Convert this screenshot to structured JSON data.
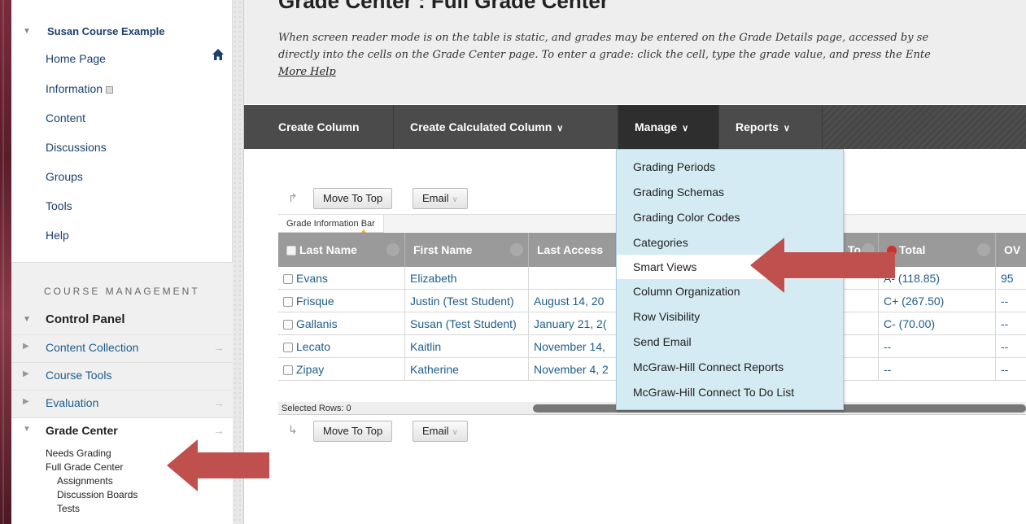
{
  "sidebar": {
    "course_title": "Susan Course Example",
    "nav": [
      "Home Page",
      "Information",
      "Content",
      "Discussions",
      "Groups",
      "Tools",
      "Help"
    ],
    "course_management_label": "COURSE MANAGEMENT",
    "control_panel_label": "Control Panel",
    "cm_items": [
      "Content Collection",
      "Course Tools",
      "Evaluation"
    ],
    "grade_center_label": "Grade Center",
    "grade_center_items": [
      "Needs Grading",
      "Full Grade Center"
    ],
    "grade_center_subitems": [
      "Assignments",
      "Discussion Boards",
      "Tests"
    ]
  },
  "main": {
    "title": "Grade Center : Full Grade Center",
    "info_line1": "When screen reader mode is on the table is static, and grades may be entered on the Grade Details page, accessed by se",
    "info_line2": "directly into the cells on the Grade Center page. To enter a grade: click the cell, type the grade value, and press the Ente",
    "more_help": "More Help"
  },
  "action_bar": {
    "create_column": "Create Column",
    "create_calculated_column": "Create Calculated Column",
    "manage": "Manage",
    "reports": "Reports"
  },
  "toolbar": {
    "move_to_top": "Move To Top",
    "email": "Email",
    "grade_information_bar": "Grade Information Bar",
    "selected_rows": "Selected Rows: 0"
  },
  "table": {
    "headers": [
      "Last Name",
      "First Name",
      "Last Access",
      "To",
      "Total",
      "OV"
    ],
    "rows": [
      [
        "Evans",
        "Elizabeth",
        "",
        "A- (118.85)",
        "95"
      ],
      [
        "Frisque",
        "Justin (Test Student)",
        "August 14, 20",
        "C+ (267.50)",
        "--"
      ],
      [
        "Gallanis",
        "Susan (Test Student)",
        "January 21, 2(",
        "C- (70.00)",
        "--"
      ],
      [
        "Lecato",
        "Kaitlin",
        "November 14,",
        "--",
        "--"
      ],
      [
        "Zipay",
        "Katherine",
        "November 4, 2",
        "--",
        "--"
      ]
    ]
  },
  "manage_menu": {
    "items": [
      "Grading Periods",
      "Grading Schemas",
      "Grading Color Codes",
      "Categories",
      "Smart Views",
      "Column Organization",
      "Row Visibility",
      "Send Email",
      "McGraw-Hill Connect Reports",
      "McGraw-Hill Connect To Do List"
    ],
    "highlighted": "Smart Views"
  },
  "colors": {
    "annotation_arrow": "#c0504d",
    "menu_bg": "#d4ebf3",
    "action_bar": "#4a4a4a",
    "link": "#1d5d8a"
  }
}
